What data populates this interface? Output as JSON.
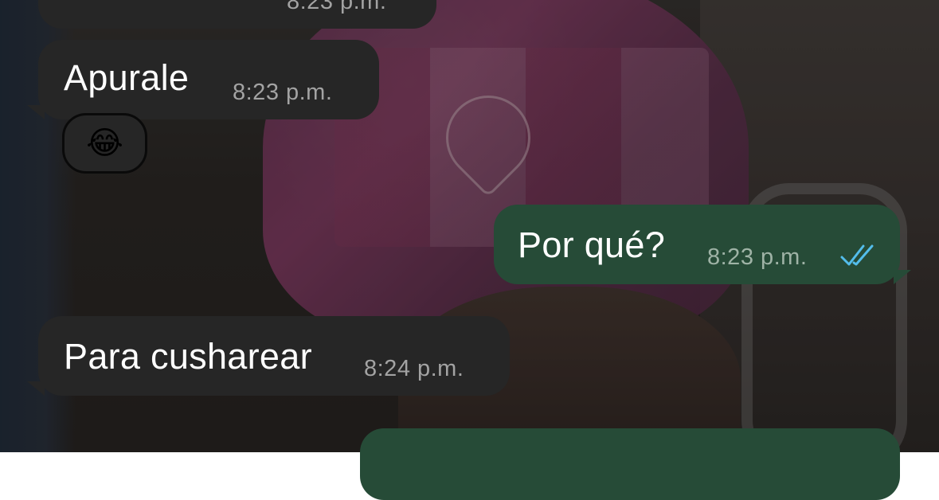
{
  "messages": [
    {
      "direction": "incoming",
      "text": "",
      "time": "8:23 p.m."
    },
    {
      "direction": "incoming",
      "text": "Apurale",
      "time": "8:23 p.m."
    },
    {
      "direction": "outgoing",
      "text": "Por qué?",
      "time": "8:23 p.m.",
      "status": "read",
      "status_icon": "double-check-icon"
    },
    {
      "direction": "incoming",
      "text": "Para cusharear",
      "time": "8:24 p.m."
    },
    {
      "direction": "outgoing",
      "text": "",
      "time": ""
    }
  ],
  "reaction": {
    "emoji": "😂",
    "icon": "tears-of-joy-emoji"
  },
  "colors": {
    "incoming_bubble": "#262626",
    "outgoing_bubble": "#264b37",
    "read_ticks": "#53bdeb",
    "timestamp": "#a3a3a3"
  }
}
